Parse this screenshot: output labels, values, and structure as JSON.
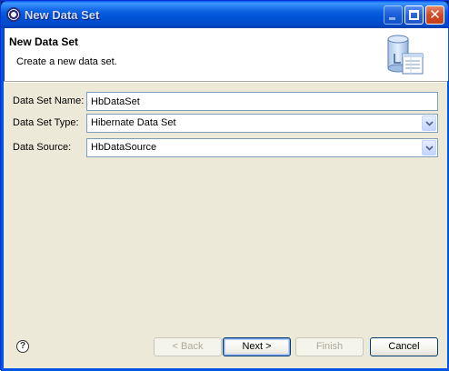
{
  "window": {
    "title": "New Data Set"
  },
  "banner": {
    "title": "New Data Set",
    "description": "Create a new data set."
  },
  "form": {
    "name_label": "Data Set Name:",
    "name_value": "HbDataSet",
    "type_label": "Data Set Type:",
    "type_value": "Hibernate Data Set",
    "source_label": "Data Source:",
    "source_value": "HbDataSource"
  },
  "buttons": {
    "back": "< Back",
    "next": "Next >",
    "finish": "Finish",
    "cancel": "Cancel",
    "help": "?"
  },
  "colors": {
    "titlebar": "#0054e3",
    "dialog_bg": "#ece9d8",
    "input_border": "#7f9db9"
  }
}
